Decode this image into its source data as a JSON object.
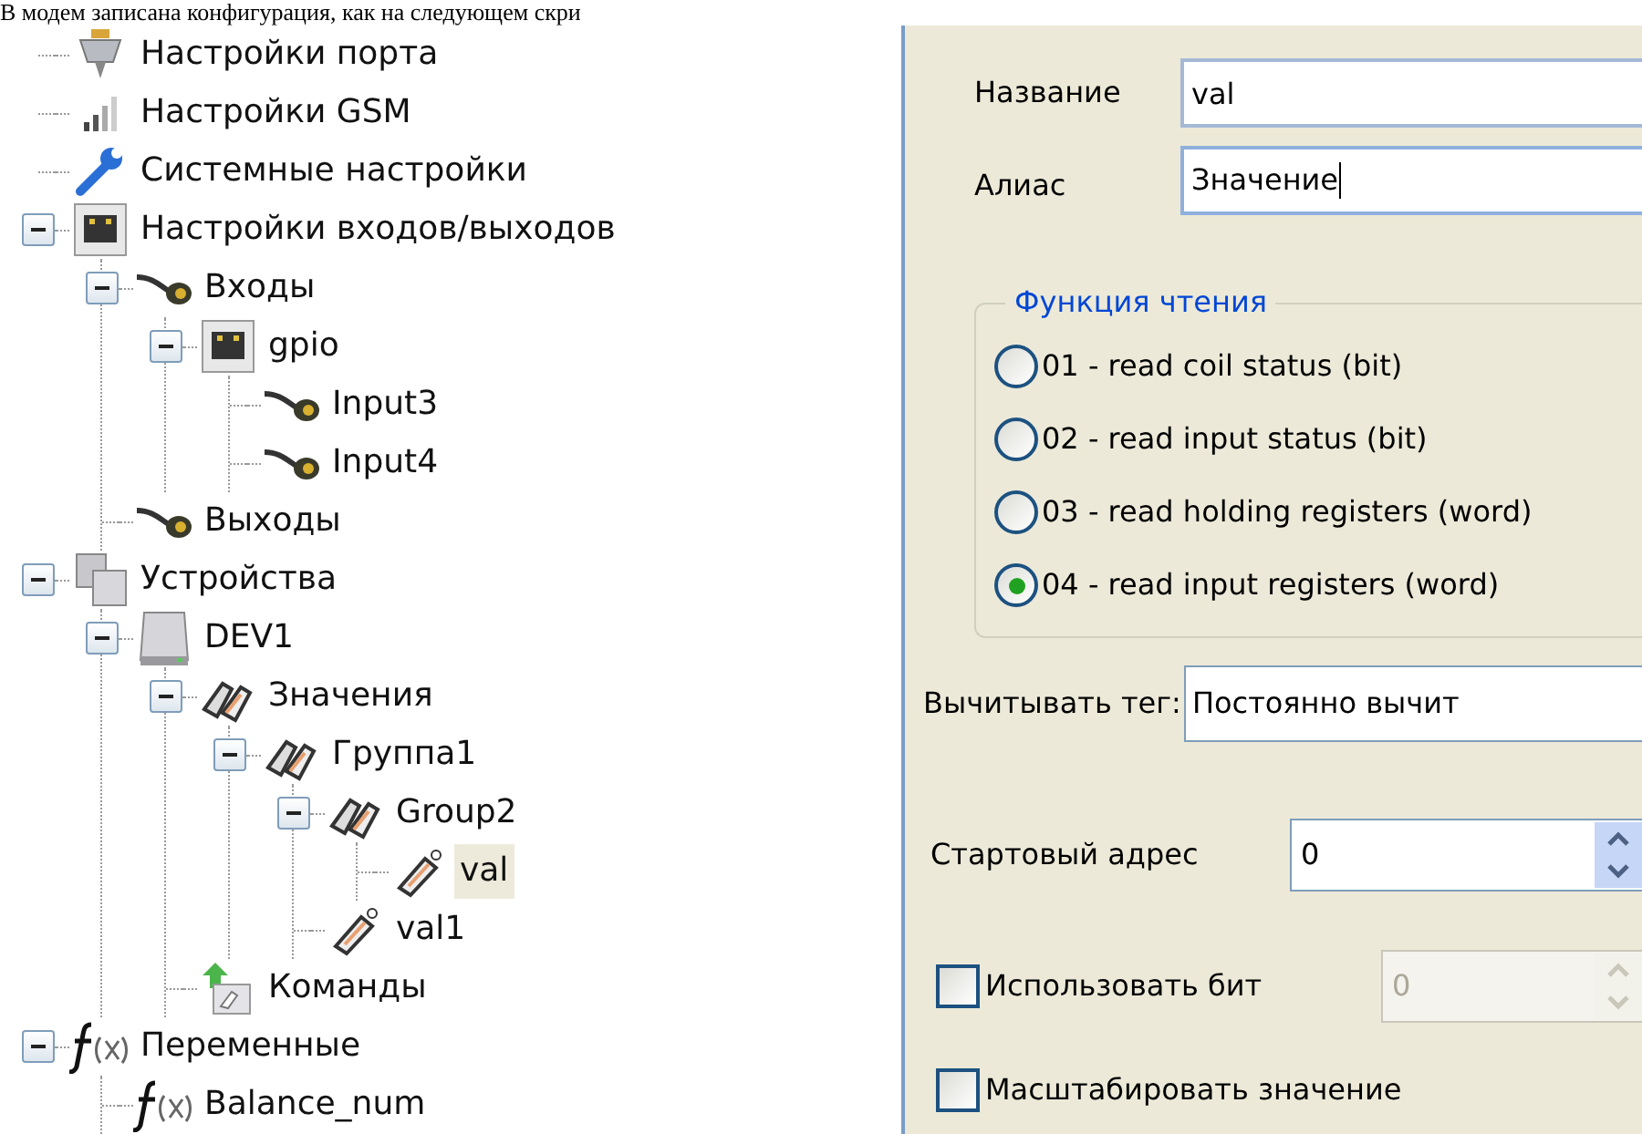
{
  "caption": "В модем записана конфигурация, как на следующем скри",
  "tree": [
    {
      "label": "Настройки порта",
      "kind": "port"
    },
    {
      "label": "Настройки GSM",
      "kind": "gsm"
    },
    {
      "label": "Системные настройки",
      "kind": "wrench"
    },
    {
      "label": "Настройки входов/выходов",
      "kind": "board",
      "expanded": true,
      "children": [
        {
          "label": "Входы",
          "kind": "cable",
          "expanded": true,
          "children": [
            {
              "label": "gpio",
              "kind": "board",
              "expanded": true,
              "children": [
                {
                  "label": "Input3",
                  "kind": "cable"
                },
                {
                  "label": "Input4",
                  "kind": "cable"
                }
              ]
            }
          ]
        },
        {
          "label": "Выходы",
          "kind": "cable"
        }
      ]
    },
    {
      "label": "Устройства",
      "kind": "devices",
      "expanded": true,
      "children": [
        {
          "label": "DEV1",
          "kind": "device",
          "expanded": true,
          "children": [
            {
              "label": "Значения",
              "kind": "tags",
              "expanded": true,
              "children": [
                {
                  "label": "Группа1",
                  "kind": "tags",
                  "expanded": true,
                  "children": [
                    {
                      "label": "Group2",
                      "kind": "tags",
                      "expanded": true,
                      "children": [
                        {
                          "label": "val",
                          "kind": "tag",
                          "selected": true
                        }
                      ]
                    },
                    {
                      "label": "val1",
                      "kind": "tag",
                      "selected": false
                    }
                  ]
                }
              ]
            },
            {
              "label": "Команды",
              "kind": "commands"
            }
          ]
        }
      ]
    },
    {
      "label": "Переменные",
      "kind": "function",
      "expanded": true,
      "children": [
        {
          "label": "Balance_num",
          "kind": "function"
        }
      ]
    }
  ],
  "form": {
    "name": {
      "label": "Название",
      "value": "val"
    },
    "alias": {
      "label": "Алиас",
      "value": "Значение",
      "focused": true
    },
    "read_function": {
      "legend": "Функция чтения",
      "options": [
        {
          "label": "01 - read coil status (bit)",
          "selected": false
        },
        {
          "label": "02 - read input status (bit)",
          "selected": false
        },
        {
          "label": "03 - read holding registers (word)",
          "selected": false
        },
        {
          "label": "04 - read input registers (word)",
          "selected": true
        }
      ]
    },
    "read_tag": {
      "label": "Вычитывать тег:",
      "value": "Постоянно вычит"
    },
    "start_address": {
      "label": "Стартовый адрес",
      "value": "0"
    },
    "use_bit": {
      "label": "Использовать бит",
      "checked": false,
      "value": "0",
      "disabled": true
    },
    "scale": {
      "label": "Масштабировать значение",
      "checked": false
    }
  }
}
